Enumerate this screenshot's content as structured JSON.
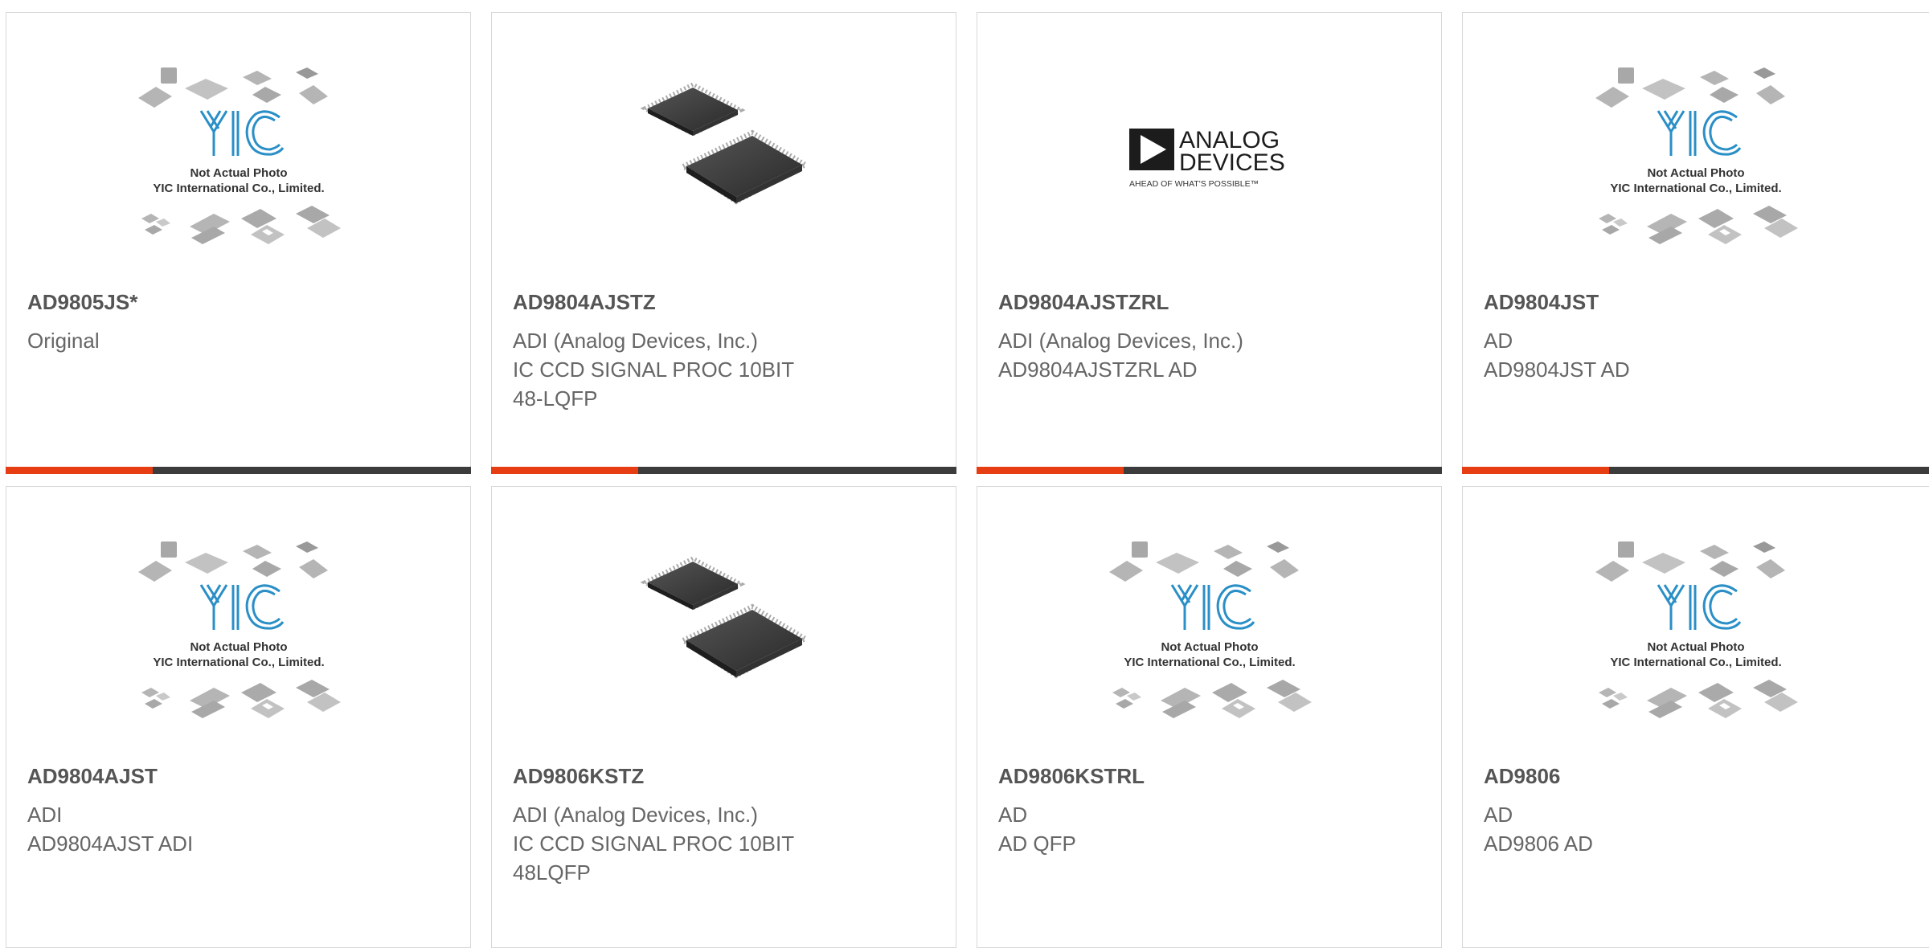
{
  "colors": {
    "accent": "#e63d12",
    "bar": "#3c3c3c",
    "yic_blue": "#2a8fc7"
  },
  "placeholder": {
    "caption1": "Not Actual Photo",
    "caption2": "YIC International Co., Limited."
  },
  "logo": {
    "line1": "ANALOG",
    "line2": "DEVICES",
    "tagline": "AHEAD OF WHAT'S POSSIBLE™"
  },
  "products": [
    {
      "part": "AD9805JS*",
      "lines": [
        "Original",
        "",
        ""
      ],
      "image": "yic-placeholder"
    },
    {
      "part": "AD9804AJSTZ",
      "lines": [
        "ADI (Analog Devices, Inc.)",
        "IC CCD SIGNAL PROC 10BIT",
        "48-LQFP"
      ],
      "image": "chip-photo"
    },
    {
      "part": "AD9804AJSTZRL",
      "lines": [
        "ADI (Analog Devices, Inc.)",
        "AD9804AJSTZRL AD",
        ""
      ],
      "image": "analog-devices-logo"
    },
    {
      "part": "AD9804JST",
      "lines": [
        "AD",
        "AD9804JST AD",
        ""
      ],
      "image": "yic-placeholder"
    },
    {
      "part": "AD9804AJST",
      "lines": [
        "ADI",
        "AD9804AJST ADI",
        ""
      ],
      "image": "yic-placeholder"
    },
    {
      "part": "AD9806KSTZ",
      "lines": [
        "ADI (Analog Devices, Inc.)",
        "IC CCD SIGNAL PROC 10BIT",
        "48LQFP"
      ],
      "image": "chip-photo"
    },
    {
      "part": "AD9806KSTRL",
      "lines": [
        "AD",
        "AD QFP",
        ""
      ],
      "image": "yic-placeholder"
    },
    {
      "part": "AD9806",
      "lines": [
        "AD",
        "AD9806 AD",
        ""
      ],
      "image": "yic-placeholder"
    }
  ]
}
